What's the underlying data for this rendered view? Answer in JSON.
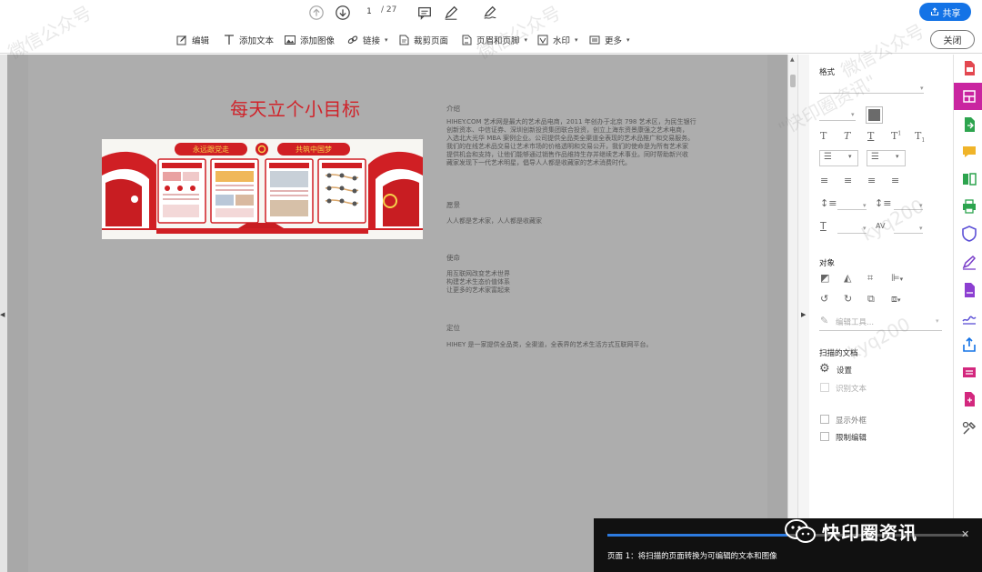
{
  "topbar": {
    "page_current": "1",
    "page_total": "/ 27",
    "share_label": "共享"
  },
  "edit_toolbar": {
    "items": [
      {
        "label": "编辑",
        "icon": "edit-icon"
      },
      {
        "label": "添加文本",
        "icon": "text-icon"
      },
      {
        "label": "添加图像",
        "icon": "image-icon"
      },
      {
        "label": "链接",
        "icon": "link-icon"
      },
      {
        "label": "裁剪页面",
        "icon": "crop-icon"
      },
      {
        "label": "页眉和页脚",
        "icon": "header-footer-icon"
      },
      {
        "label": "水印",
        "icon": "watermark-icon"
      },
      {
        "label": "更多",
        "icon": "more-icon"
      }
    ],
    "close_label": "关闭"
  },
  "document": {
    "title": "每天立个小目标",
    "banner_slogans": [
      "永远跟党走",
      "共筑中国梦"
    ],
    "sections": [
      {
        "heading": "介绍",
        "lines": [
          "HIHEY.COM 艺术网是最大的艺术品电商，2011 年创办于北京 798 艺术区，为民生银行",
          "创新资本、中信证券、深圳创新投资集团联合投资，创立上海东资景康强之艺术电商，",
          "入选北大光华 MBA 案例企业。公司提供全品类全渠道全表现的艺术品推广和交易服务。",
          "我们的在线艺术品交易让艺术市场的价格透明和交易公开，我们的使命是为所有艺术家",
          "提供机会和支持，让他们能够通过销售作品维持生存并继续艺术事业。同时帮助新兴收",
          "藏家发现下一代艺术明星，倡导人人都是收藏家的艺术消费时代。"
        ]
      },
      {
        "heading": "愿景",
        "lines": [
          "人人都是艺术家，人人都是收藏家"
        ]
      },
      {
        "heading": "使命",
        "lines": [
          "用互联网改变艺术世界",
          "构建艺术生态价值体系",
          "让更多的艺术家富起来"
        ]
      },
      {
        "heading": "定位",
        "lines": [
          "HIHEY 是一家提供全品类，全渠道，全表界的艺术生活方式互联网平台。"
        ]
      }
    ]
  },
  "format_panel": {
    "format_heading": "格式",
    "objects_heading": "对象",
    "edit_tool_label": "编辑工具...",
    "scanned_heading": "扫描的文档",
    "settings_label": "设置",
    "recognize_text_label": "识别文本",
    "show_outline_label": "显示外框",
    "restrict_edit_label": "限制编辑",
    "av_label": "AV"
  },
  "popup": {
    "message": "页面 1：将扫描的页面转换为可编辑的文本和图像",
    "progress": 0.5
  },
  "badge": {
    "text": "快印圈资讯"
  },
  "watermark": {
    "text": "微信公众号",
    "handle": "kyq200",
    "brand": "\"快印圈资讯\""
  },
  "colors": {
    "accent": "#1473e6",
    "title_red": "#d0232a",
    "tool_active": "#c925a0"
  }
}
